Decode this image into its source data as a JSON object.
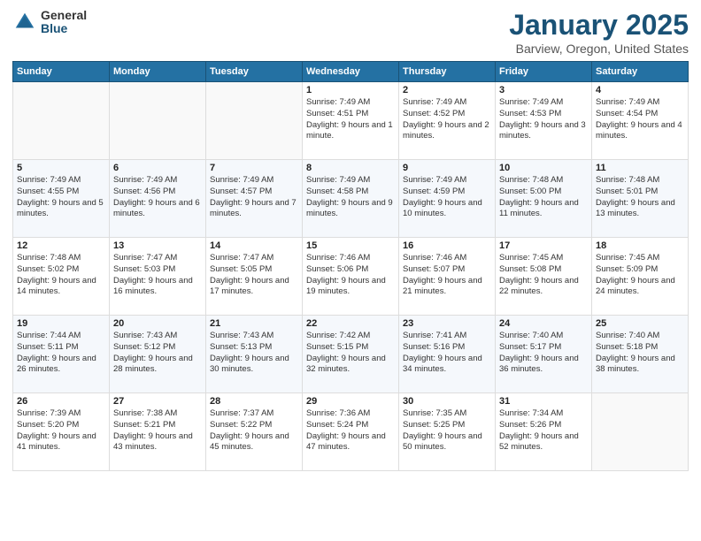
{
  "header": {
    "logo_general": "General",
    "logo_blue": "Blue",
    "month_title": "January 2025",
    "location": "Barview, Oregon, United States"
  },
  "weekdays": [
    "Sunday",
    "Monday",
    "Tuesday",
    "Wednesday",
    "Thursday",
    "Friday",
    "Saturday"
  ],
  "weeks": [
    [
      {
        "day": "",
        "sunrise": "",
        "sunset": "",
        "daylight": ""
      },
      {
        "day": "",
        "sunrise": "",
        "sunset": "",
        "daylight": ""
      },
      {
        "day": "",
        "sunrise": "",
        "sunset": "",
        "daylight": ""
      },
      {
        "day": "1",
        "sunrise": "Sunrise: 7:49 AM",
        "sunset": "Sunset: 4:51 PM",
        "daylight": "Daylight: 9 hours and 1 minute."
      },
      {
        "day": "2",
        "sunrise": "Sunrise: 7:49 AM",
        "sunset": "Sunset: 4:52 PM",
        "daylight": "Daylight: 9 hours and 2 minutes."
      },
      {
        "day": "3",
        "sunrise": "Sunrise: 7:49 AM",
        "sunset": "Sunset: 4:53 PM",
        "daylight": "Daylight: 9 hours and 3 minutes."
      },
      {
        "day": "4",
        "sunrise": "Sunrise: 7:49 AM",
        "sunset": "Sunset: 4:54 PM",
        "daylight": "Daylight: 9 hours and 4 minutes."
      }
    ],
    [
      {
        "day": "5",
        "sunrise": "Sunrise: 7:49 AM",
        "sunset": "Sunset: 4:55 PM",
        "daylight": "Daylight: 9 hours and 5 minutes."
      },
      {
        "day": "6",
        "sunrise": "Sunrise: 7:49 AM",
        "sunset": "Sunset: 4:56 PM",
        "daylight": "Daylight: 9 hours and 6 minutes."
      },
      {
        "day": "7",
        "sunrise": "Sunrise: 7:49 AM",
        "sunset": "Sunset: 4:57 PM",
        "daylight": "Daylight: 9 hours and 7 minutes."
      },
      {
        "day": "8",
        "sunrise": "Sunrise: 7:49 AM",
        "sunset": "Sunset: 4:58 PM",
        "daylight": "Daylight: 9 hours and 9 minutes."
      },
      {
        "day": "9",
        "sunrise": "Sunrise: 7:49 AM",
        "sunset": "Sunset: 4:59 PM",
        "daylight": "Daylight: 9 hours and 10 minutes."
      },
      {
        "day": "10",
        "sunrise": "Sunrise: 7:48 AM",
        "sunset": "Sunset: 5:00 PM",
        "daylight": "Daylight: 9 hours and 11 minutes."
      },
      {
        "day": "11",
        "sunrise": "Sunrise: 7:48 AM",
        "sunset": "Sunset: 5:01 PM",
        "daylight": "Daylight: 9 hours and 13 minutes."
      }
    ],
    [
      {
        "day": "12",
        "sunrise": "Sunrise: 7:48 AM",
        "sunset": "Sunset: 5:02 PM",
        "daylight": "Daylight: 9 hours and 14 minutes."
      },
      {
        "day": "13",
        "sunrise": "Sunrise: 7:47 AM",
        "sunset": "Sunset: 5:03 PM",
        "daylight": "Daylight: 9 hours and 16 minutes."
      },
      {
        "day": "14",
        "sunrise": "Sunrise: 7:47 AM",
        "sunset": "Sunset: 5:05 PM",
        "daylight": "Daylight: 9 hours and 17 minutes."
      },
      {
        "day": "15",
        "sunrise": "Sunrise: 7:46 AM",
        "sunset": "Sunset: 5:06 PM",
        "daylight": "Daylight: 9 hours and 19 minutes."
      },
      {
        "day": "16",
        "sunrise": "Sunrise: 7:46 AM",
        "sunset": "Sunset: 5:07 PM",
        "daylight": "Daylight: 9 hours and 21 minutes."
      },
      {
        "day": "17",
        "sunrise": "Sunrise: 7:45 AM",
        "sunset": "Sunset: 5:08 PM",
        "daylight": "Daylight: 9 hours and 22 minutes."
      },
      {
        "day": "18",
        "sunrise": "Sunrise: 7:45 AM",
        "sunset": "Sunset: 5:09 PM",
        "daylight": "Daylight: 9 hours and 24 minutes."
      }
    ],
    [
      {
        "day": "19",
        "sunrise": "Sunrise: 7:44 AM",
        "sunset": "Sunset: 5:11 PM",
        "daylight": "Daylight: 9 hours and 26 minutes."
      },
      {
        "day": "20",
        "sunrise": "Sunrise: 7:43 AM",
        "sunset": "Sunset: 5:12 PM",
        "daylight": "Daylight: 9 hours and 28 minutes."
      },
      {
        "day": "21",
        "sunrise": "Sunrise: 7:43 AM",
        "sunset": "Sunset: 5:13 PM",
        "daylight": "Daylight: 9 hours and 30 minutes."
      },
      {
        "day": "22",
        "sunrise": "Sunrise: 7:42 AM",
        "sunset": "Sunset: 5:15 PM",
        "daylight": "Daylight: 9 hours and 32 minutes."
      },
      {
        "day": "23",
        "sunrise": "Sunrise: 7:41 AM",
        "sunset": "Sunset: 5:16 PM",
        "daylight": "Daylight: 9 hours and 34 minutes."
      },
      {
        "day": "24",
        "sunrise": "Sunrise: 7:40 AM",
        "sunset": "Sunset: 5:17 PM",
        "daylight": "Daylight: 9 hours and 36 minutes."
      },
      {
        "day": "25",
        "sunrise": "Sunrise: 7:40 AM",
        "sunset": "Sunset: 5:18 PM",
        "daylight": "Daylight: 9 hours and 38 minutes."
      }
    ],
    [
      {
        "day": "26",
        "sunrise": "Sunrise: 7:39 AM",
        "sunset": "Sunset: 5:20 PM",
        "daylight": "Daylight: 9 hours and 41 minutes."
      },
      {
        "day": "27",
        "sunrise": "Sunrise: 7:38 AM",
        "sunset": "Sunset: 5:21 PM",
        "daylight": "Daylight: 9 hours and 43 minutes."
      },
      {
        "day": "28",
        "sunrise": "Sunrise: 7:37 AM",
        "sunset": "Sunset: 5:22 PM",
        "daylight": "Daylight: 9 hours and 45 minutes."
      },
      {
        "day": "29",
        "sunrise": "Sunrise: 7:36 AM",
        "sunset": "Sunset: 5:24 PM",
        "daylight": "Daylight: 9 hours and 47 minutes."
      },
      {
        "day": "30",
        "sunrise": "Sunrise: 7:35 AM",
        "sunset": "Sunset: 5:25 PM",
        "daylight": "Daylight: 9 hours and 50 minutes."
      },
      {
        "day": "31",
        "sunrise": "Sunrise: 7:34 AM",
        "sunset": "Sunset: 5:26 PM",
        "daylight": "Daylight: 9 hours and 52 minutes."
      },
      {
        "day": "",
        "sunrise": "",
        "sunset": "",
        "daylight": ""
      }
    ]
  ]
}
